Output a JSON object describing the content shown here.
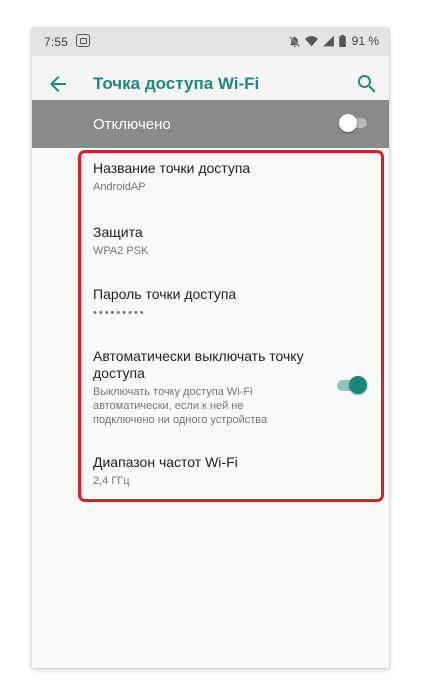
{
  "status_bar": {
    "time": "7:55",
    "battery": "91 %",
    "icons": [
      "notification-icon",
      "mute-icon",
      "wifi-hotspot-icon",
      "signal-icon",
      "battery-icon"
    ]
  },
  "app_bar": {
    "title": "Точка доступа Wi-Fi",
    "title_color": "#1e8a7a",
    "icons": [
      "back-arrow-icon",
      "search-icon"
    ]
  },
  "master_switch": {
    "label": "Отключено",
    "state": "off",
    "background": "#8a8a8a"
  },
  "settings": [
    {
      "title": "Название точки доступа",
      "subtitle": "AndroidAP"
    },
    {
      "title": "Защита",
      "subtitle": "WPA2 PSK"
    },
    {
      "title": "Пароль точки доступа",
      "subtitle": "•••••••••"
    },
    {
      "title": "Автоматически выключать точку доступа",
      "subtitle": "Выключать точку доступа Wi-Fi автоматически, если к ней не подключено ни одного устройства",
      "toggle": "on"
    },
    {
      "title": "Диапазон частот Wi-Fi",
      "subtitle": "2,4 ГГц"
    }
  ],
  "accent_color": "#138a7a",
  "highlight_color": "#e31b23"
}
